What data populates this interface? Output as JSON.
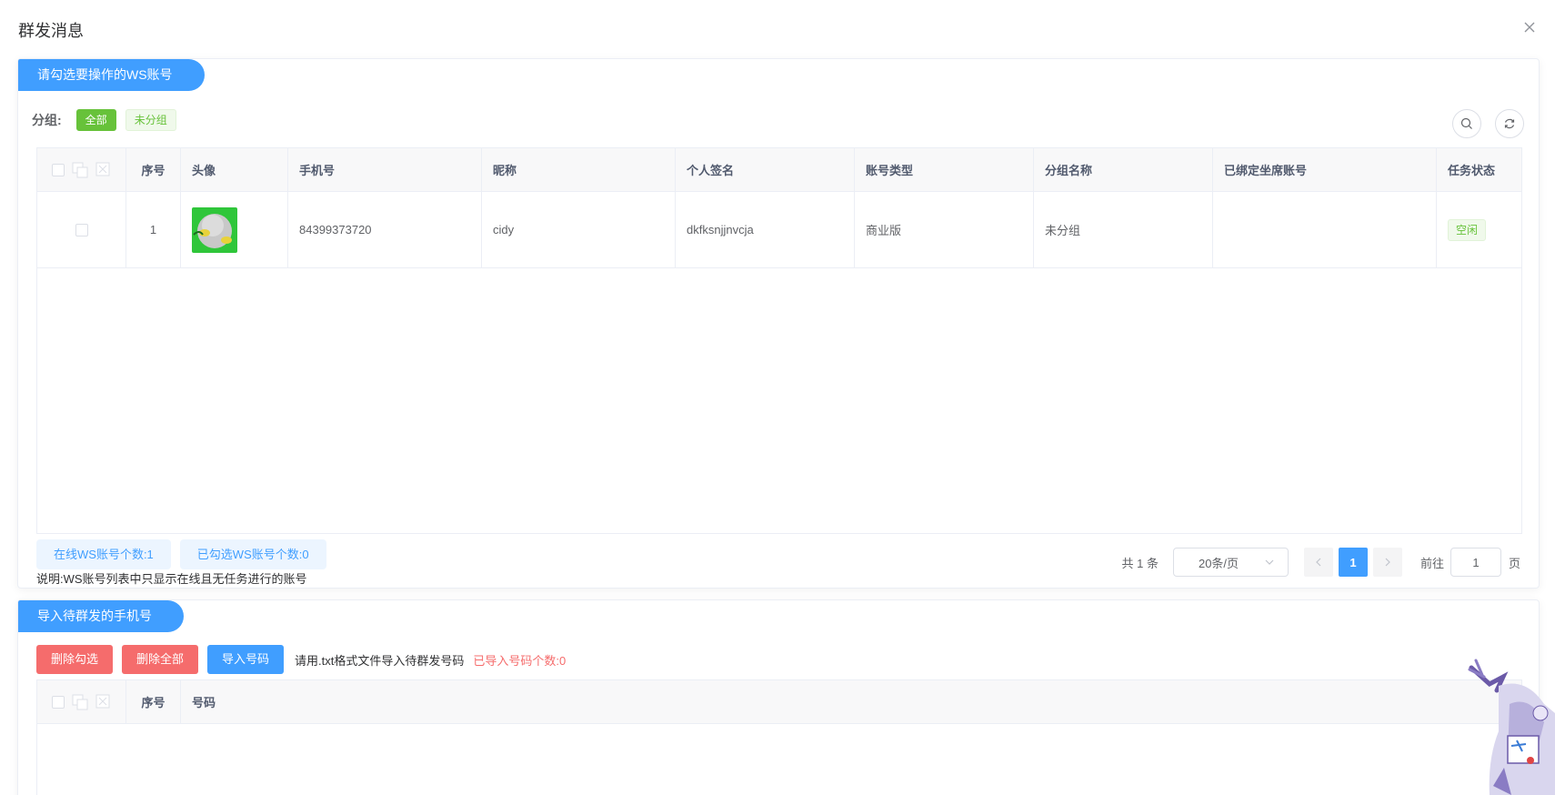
{
  "dialog": {
    "title": "群发消息"
  },
  "account_section": {
    "header": "请勾选要操作的WS账号",
    "group_label": "分组:",
    "group_tags": [
      "全部",
      "未分组"
    ],
    "columns": [
      "序号",
      "头像",
      "手机号",
      "昵称",
      "个人签名",
      "账号类型",
      "分组名称",
      "已绑定坐席账号",
      "任务状态"
    ],
    "rows": [
      {
        "index": "1",
        "phone": "84399373720",
        "nickname": "cidy",
        "signature": "dkfksnjjnvcja",
        "account_type": "商业版",
        "group": "未分组",
        "bound_seat": "",
        "status": "空闲"
      }
    ],
    "online_count": "在线WS账号个数:1",
    "selected_count": "已勾选WS账号个数:0",
    "note": "说明:WS账号列表中只显示在线且无任务进行的账号",
    "pager": {
      "total": "共 1 条",
      "page_size": "20条/页",
      "current_page": "1",
      "goto_label": "前往",
      "goto_value": "1",
      "goto_suffix": "页"
    }
  },
  "import_section": {
    "header": "导入待群发的手机号",
    "btn_delete_selected": "删除勾选",
    "btn_delete_all": "删除全部",
    "btn_import": "导入号码",
    "hint": "请用.txt格式文件导入待群发号码",
    "imported_count": "已导入号码个数:0",
    "columns": [
      "序号",
      "号码"
    ]
  },
  "colors": {
    "primary": "#409eff",
    "success": "#67c23a",
    "danger": "#f56c6c"
  }
}
